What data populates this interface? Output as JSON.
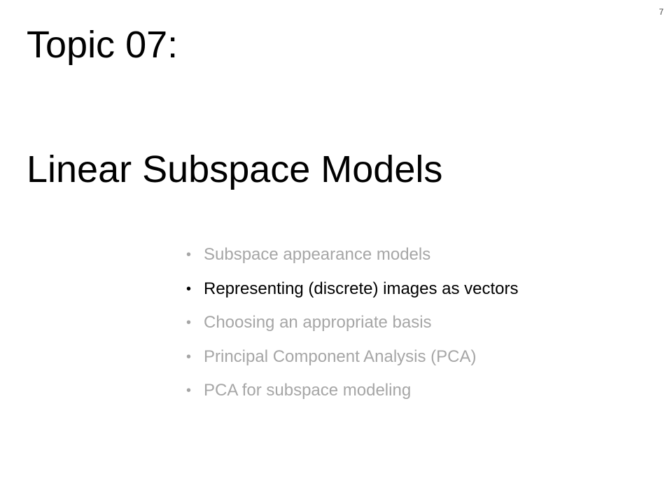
{
  "slide": {
    "number": "7",
    "title_line1": "Topic 07:",
    "title_line2": "Linear Subspace Models",
    "bullet_glyph": "•",
    "agenda": [
      {
        "label": "Subspace appearance models",
        "active": false
      },
      {
        "label": "Representing (discrete) images as vectors",
        "active": true
      },
      {
        "label": "Choosing an appropriate basis",
        "active": false
      },
      {
        "label": "Principal Component Analysis (PCA)",
        "active": false
      },
      {
        "label": "PCA for subspace modeling",
        "active": false
      }
    ]
  },
  "colors": {
    "active_text": "#000000",
    "inactive_text": "#a6a6a6",
    "background": "#ffffff"
  }
}
